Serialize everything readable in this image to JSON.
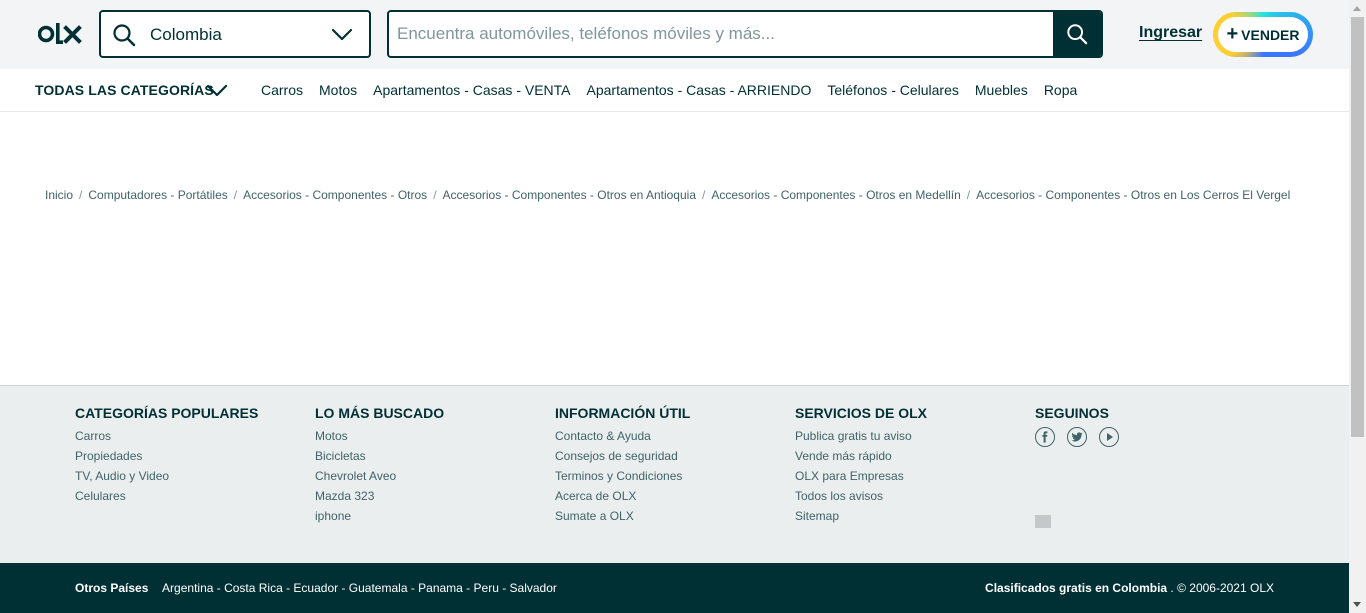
{
  "header": {
    "logo_text": "olx",
    "location": "Colombia",
    "search_placeholder": "Encuentra automóviles, teléfonos móviles y más...",
    "login_label": "Ingresar",
    "sell_label": "VENDER"
  },
  "catnav": {
    "all_label": "TODAS LAS CATEGORÍAS",
    "items": [
      "Carros",
      "Motos",
      "Apartamentos - Casas - VENTA",
      "Apartamentos - Casas - ARRIENDO",
      "Teléfonos - Celulares",
      "Muebles",
      "Ropa"
    ]
  },
  "breadcrumb": [
    "Inicio",
    "Computadores - Portátiles",
    "Accesorios - Componentes - Otros",
    "Accesorios - Componentes - Otros en Antioquia",
    "Accesorios - Componentes - Otros en Medellín",
    "Accesorios - Componentes - Otros en Los Cerros El Vergel"
  ],
  "breadcrumb_separator": "/",
  "footer": {
    "columns": [
      {
        "title": "CATEGORÍAS POPULARES",
        "links": [
          "Carros",
          "Propiedades",
          "TV, Audio y Video",
          "Celulares"
        ]
      },
      {
        "title": "LO MÁS BUSCADO",
        "links": [
          "Motos",
          "Bicicletas",
          "Chevrolet Aveo",
          "Mazda 323",
          "iphone"
        ]
      },
      {
        "title": "INFORMACIÓN ÚTIL",
        "links": [
          "Contacto & Ayuda",
          "Consejos de seguridad",
          "Terminos y Condiciones",
          "Acerca de OLX",
          "Sumate a OLX"
        ]
      },
      {
        "title": "SERVICIOS DE OLX",
        "links": [
          "Publica gratis tu aviso",
          "Vende más rápido",
          "OLX para Empresas",
          "Todos los avisos",
          "Sitemap"
        ]
      }
    ],
    "follow_title": "SEGUINOS",
    "social_icons": [
      "facebook-icon",
      "twitter-icon",
      "youtube-icon"
    ]
  },
  "bottombar": {
    "other_countries_label": "Otros Países",
    "countries": "Argentina - Costa Rica - Ecuador - Guatemala - Panama - Peru - Salvador",
    "classifieds_label": "Clasificados gratis en Colombia",
    "copyright": ". © 2006-2021 OLX"
  },
  "colors": {
    "brand": "#002f34",
    "header_bg": "#f2f4f5",
    "footer_bg": "#ebeeef",
    "sell_ring": [
      "#23e5db",
      "#3a77ff",
      "#ffce32"
    ]
  }
}
